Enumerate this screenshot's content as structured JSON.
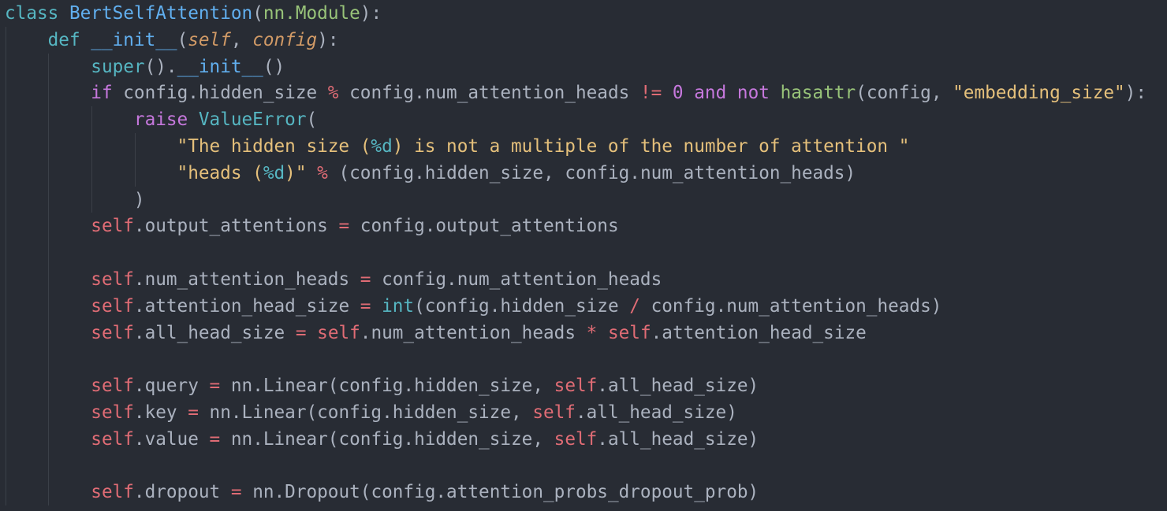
{
  "editor": {
    "language": "python",
    "theme": "dark",
    "background": "#282c34",
    "lines": [
      {
        "indent": 0,
        "tokens": [
          {
            "c": "ckw",
            "t": "class"
          },
          {
            "c": "pl",
            "t": " "
          },
          {
            "c": "cls",
            "t": "BertSelfAttention"
          },
          {
            "c": "pl",
            "t": "("
          },
          {
            "c": "inh",
            "t": "nn.Module"
          },
          {
            "c": "pl",
            "t": "):"
          }
        ]
      },
      {
        "indent": 1,
        "tokens": [
          {
            "c": "dkw",
            "t": "def"
          },
          {
            "c": "pl",
            "t": " "
          },
          {
            "c": "fn",
            "t": "__init__"
          },
          {
            "c": "pl",
            "t": "("
          },
          {
            "c": "prm",
            "t": "self"
          },
          {
            "c": "pl",
            "t": ", "
          },
          {
            "c": "prm",
            "t": "config"
          },
          {
            "c": "pl",
            "t": "):"
          }
        ]
      },
      {
        "indent": 2,
        "tokens": [
          {
            "c": "bt",
            "t": "super"
          },
          {
            "c": "pl",
            "t": "()."
          },
          {
            "c": "fn",
            "t": "__init__"
          },
          {
            "c": "pl",
            "t": "()"
          }
        ]
      },
      {
        "indent": 2,
        "tokens": [
          {
            "c": "kw",
            "t": "if"
          },
          {
            "c": "pl",
            "t": " config.hidden_size "
          },
          {
            "c": "op",
            "t": "%"
          },
          {
            "c": "pl",
            "t": " config.num_attention_heads "
          },
          {
            "c": "op",
            "t": "!="
          },
          {
            "c": "pl",
            "t": " "
          },
          {
            "c": "num",
            "t": "0"
          },
          {
            "c": "pl",
            "t": " "
          },
          {
            "c": "kw",
            "t": "and"
          },
          {
            "c": "pl",
            "t": " "
          },
          {
            "c": "kw",
            "t": "not"
          },
          {
            "c": "pl",
            "t": " "
          },
          {
            "c": "bi",
            "t": "hasattr"
          },
          {
            "c": "pl",
            "t": "(config, "
          },
          {
            "c": "str",
            "t": "\"embedding_size\""
          },
          {
            "c": "pl",
            "t": "):"
          }
        ]
      },
      {
        "indent": 3,
        "tokens": [
          {
            "c": "kw",
            "t": "raise"
          },
          {
            "c": "pl",
            "t": " "
          },
          {
            "c": "exc",
            "t": "ValueError"
          },
          {
            "c": "pl",
            "t": "("
          }
        ]
      },
      {
        "indent": 4,
        "tokens": [
          {
            "c": "str",
            "t": "\"The hidden size ("
          },
          {
            "c": "fmt",
            "t": "%d"
          },
          {
            "c": "str",
            "t": ") is not a multiple of the number of attention \""
          }
        ]
      },
      {
        "indent": 4,
        "tokens": [
          {
            "c": "str",
            "t": "\"heads ("
          },
          {
            "c": "fmt",
            "t": "%d"
          },
          {
            "c": "str",
            "t": ")\""
          },
          {
            "c": "pl",
            "t": " "
          },
          {
            "c": "op",
            "t": "%"
          },
          {
            "c": "pl",
            "t": " (config.hidden_size, config.num_attention_heads)"
          }
        ]
      },
      {
        "indent": 3,
        "tokens": [
          {
            "c": "pl",
            "t": ")"
          }
        ]
      },
      {
        "indent": 2,
        "tokens": [
          {
            "c": "slf",
            "t": "self"
          },
          {
            "c": "pl",
            "t": ".output_attentions "
          },
          {
            "c": "op",
            "t": "="
          },
          {
            "c": "pl",
            "t": " config.output_attentions"
          }
        ]
      },
      {
        "indent": 0,
        "tokens": []
      },
      {
        "indent": 2,
        "tokens": [
          {
            "c": "slf",
            "t": "self"
          },
          {
            "c": "pl",
            "t": ".num_attention_heads "
          },
          {
            "c": "op",
            "t": "="
          },
          {
            "c": "pl",
            "t": " config.num_attention_heads"
          }
        ]
      },
      {
        "indent": 2,
        "tokens": [
          {
            "c": "slf",
            "t": "self"
          },
          {
            "c": "pl",
            "t": ".attention_head_size "
          },
          {
            "c": "op",
            "t": "="
          },
          {
            "c": "pl",
            "t": " "
          },
          {
            "c": "bt",
            "t": "int"
          },
          {
            "c": "pl",
            "t": "(config.hidden_size "
          },
          {
            "c": "op",
            "t": "/"
          },
          {
            "c": "pl",
            "t": " config.num_attention_heads)"
          }
        ]
      },
      {
        "indent": 2,
        "tokens": [
          {
            "c": "slf",
            "t": "self"
          },
          {
            "c": "pl",
            "t": ".all_head_size "
          },
          {
            "c": "op",
            "t": "="
          },
          {
            "c": "pl",
            "t": " "
          },
          {
            "c": "slf",
            "t": "self"
          },
          {
            "c": "pl",
            "t": ".num_attention_heads "
          },
          {
            "c": "op",
            "t": "*"
          },
          {
            "c": "pl",
            "t": " "
          },
          {
            "c": "slf",
            "t": "self"
          },
          {
            "c": "pl",
            "t": ".attention_head_size"
          }
        ]
      },
      {
        "indent": 0,
        "tokens": []
      },
      {
        "indent": 2,
        "tokens": [
          {
            "c": "slf",
            "t": "self"
          },
          {
            "c": "pl",
            "t": ".query "
          },
          {
            "c": "op",
            "t": "="
          },
          {
            "c": "pl",
            "t": " nn.Linear(config.hidden_size, "
          },
          {
            "c": "slf",
            "t": "self"
          },
          {
            "c": "pl",
            "t": ".all_head_size)"
          }
        ]
      },
      {
        "indent": 2,
        "tokens": [
          {
            "c": "slf",
            "t": "self"
          },
          {
            "c": "pl",
            "t": ".key "
          },
          {
            "c": "op",
            "t": "="
          },
          {
            "c": "pl",
            "t": " nn.Linear(config.hidden_size, "
          },
          {
            "c": "slf",
            "t": "self"
          },
          {
            "c": "pl",
            "t": ".all_head_size)"
          }
        ]
      },
      {
        "indent": 2,
        "tokens": [
          {
            "c": "slf",
            "t": "self"
          },
          {
            "c": "pl",
            "t": ".value "
          },
          {
            "c": "op",
            "t": "="
          },
          {
            "c": "pl",
            "t": " nn.Linear(config.hidden_size, "
          },
          {
            "c": "slf",
            "t": "self"
          },
          {
            "c": "pl",
            "t": ".all_head_size)"
          }
        ]
      },
      {
        "indent": 0,
        "tokens": []
      },
      {
        "indent": 2,
        "tokens": [
          {
            "c": "slf",
            "t": "self"
          },
          {
            "c": "pl",
            "t": ".dropout "
          },
          {
            "c": "op",
            "t": "="
          },
          {
            "c": "pl",
            "t": " nn.Dropout(config.attention_probs_dropout_prob)"
          }
        ]
      }
    ]
  }
}
